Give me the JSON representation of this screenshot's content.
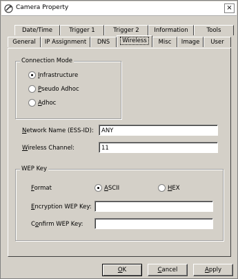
{
  "window": {
    "title": "Camera Property",
    "close_glyph": "×"
  },
  "tabs_row1": [
    {
      "label": "Date/Time"
    },
    {
      "label": "Trigger 1"
    },
    {
      "label": "Trigger 2"
    },
    {
      "label": "Information"
    },
    {
      "label": "Tools"
    }
  ],
  "tabs_row2": [
    {
      "label": "General"
    },
    {
      "label": "IP Assignment"
    },
    {
      "label": "DNS"
    },
    {
      "label": "Wireless"
    },
    {
      "label": "Misc"
    },
    {
      "label": "Image"
    },
    {
      "label": "User"
    }
  ],
  "connection_mode": {
    "group_label": "Connection Mode",
    "options": [
      {
        "label": "Infrastructure",
        "mnemonic": "I",
        "rest": "nfrastructure",
        "checked": true
      },
      {
        "label": "Pseudo Adhoc",
        "mnemonic": "P",
        "rest": "seudo Adhoc",
        "checked": false
      },
      {
        "label": "Adhoc",
        "mnemonic": "A",
        "rest": "dhoc",
        "checked": false
      }
    ]
  },
  "network_name": {
    "label": "Network Name (ESS-ID):",
    "mnemonic": "N",
    "rest": "etwork Name (ESS-ID):",
    "value": "ANY"
  },
  "wireless_channel": {
    "label": "Wireless Channel:",
    "mnemonic": "W",
    "rest": "ireless Channel:",
    "value": "11"
  },
  "wep": {
    "group_label": "WEP Key",
    "format_label": "Format",
    "format_mnemonic": "F",
    "format_rest": "ormat",
    "format_options": [
      {
        "label": "ASCII",
        "mnemonic": "A",
        "rest": "SCII",
        "checked": true
      },
      {
        "label": "HEX",
        "mnemonic": "H",
        "rest": "EX",
        "checked": false
      }
    ],
    "encryption_label": "Encryption WEP Key:",
    "encryption_mnemonic": "E",
    "encryption_rest": "ncryption WEP Key:",
    "encryption_value": "",
    "confirm_label": "Confirm WEP Key:",
    "confirm_pre": "C",
    "confirm_mnemonic": "o",
    "confirm_rest": "nfirm WEP Key:",
    "confirm_value": ""
  },
  "buttons": {
    "ok": {
      "label": "OK",
      "mnemonic": "O",
      "rest": "K"
    },
    "cancel": {
      "label": "Cancel",
      "mnemonic": "C",
      "rest": "ancel"
    },
    "apply": {
      "label": "Apply",
      "mnemonic": "A",
      "rest": "pply"
    }
  }
}
